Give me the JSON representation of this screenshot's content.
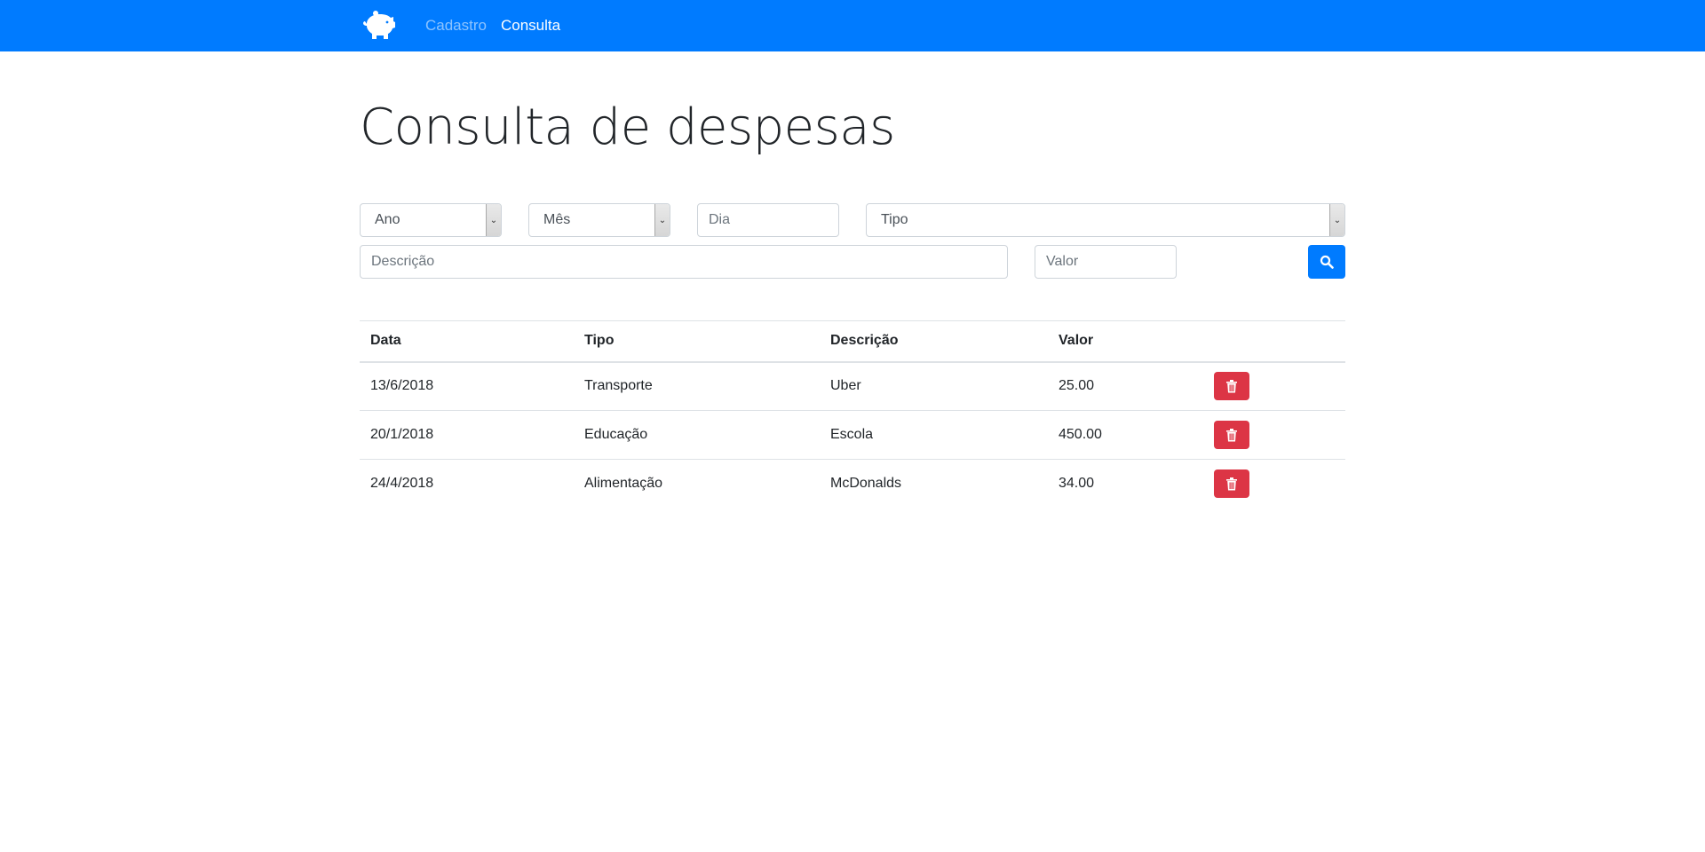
{
  "navbar": {
    "brand_icon": "piggy-bank-icon",
    "links": [
      {
        "label": "Cadastro",
        "active": false
      },
      {
        "label": "Consulta",
        "active": true
      }
    ]
  },
  "page": {
    "title": "Consulta de despesas"
  },
  "filters": {
    "ano": "Ano",
    "mes": "Mês",
    "dia_placeholder": "Dia",
    "tipo": "Tipo",
    "descricao_placeholder": "Descrição",
    "valor_placeholder": "Valor",
    "search_icon": "search-icon"
  },
  "table": {
    "headers": [
      "Data",
      "Tipo",
      "Descrição",
      "Valor"
    ],
    "rows": [
      {
        "data": "13/6/2018",
        "tipo": "Transporte",
        "descricao": "Uber",
        "valor": "25.00"
      },
      {
        "data": "20/1/2018",
        "tipo": "Educação",
        "descricao": "Escola",
        "valor": "450.00"
      },
      {
        "data": "24/4/2018",
        "tipo": "Alimentação",
        "descricao": "McDonalds",
        "valor": "34.00"
      }
    ],
    "delete_icon": "trash-icon"
  },
  "colors": {
    "primary": "#007bff",
    "danger": "#dc3545",
    "border": "#ced4da"
  }
}
